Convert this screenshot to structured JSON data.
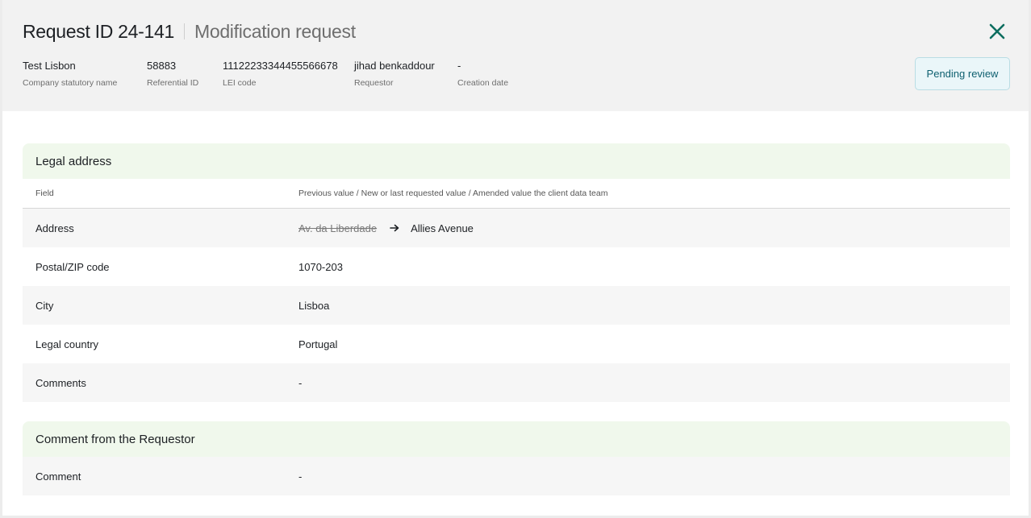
{
  "header": {
    "request_id": "Request ID 24-141",
    "request_type": "Modification request",
    "status": "Pending review",
    "meta": [
      {
        "value": "Test Lisbon",
        "label": "Company statutory name"
      },
      {
        "value": "58883",
        "label": "Referential ID"
      },
      {
        "value": "11122233344455566678",
        "label": "LEI code"
      },
      {
        "value": "jihad benkaddour",
        "label": "Requestor"
      },
      {
        "value": "-",
        "label": "Creation date"
      }
    ]
  },
  "legal_address": {
    "title": "Legal address",
    "col_field": "Field",
    "col_values": "Previous value / New or last requested value / Amended value the client data team",
    "rows": [
      {
        "field": "Address",
        "previous": "Av. da Liberdade",
        "value": "Allies Avenue"
      },
      {
        "field": "Postal/ZIP code",
        "value": "1070-203"
      },
      {
        "field": "City",
        "value": "Lisboa"
      },
      {
        "field": "Legal country",
        "value": "Portugal"
      },
      {
        "field": "Comments",
        "value": "-"
      }
    ]
  },
  "requestor_comment": {
    "title": "Comment from the Requestor",
    "field": "Comment",
    "value": "-"
  },
  "colors": {
    "accent": "#0d6e5f",
    "section_header_bg": "#f0f8ec",
    "status_bg": "#eaf6f9"
  }
}
